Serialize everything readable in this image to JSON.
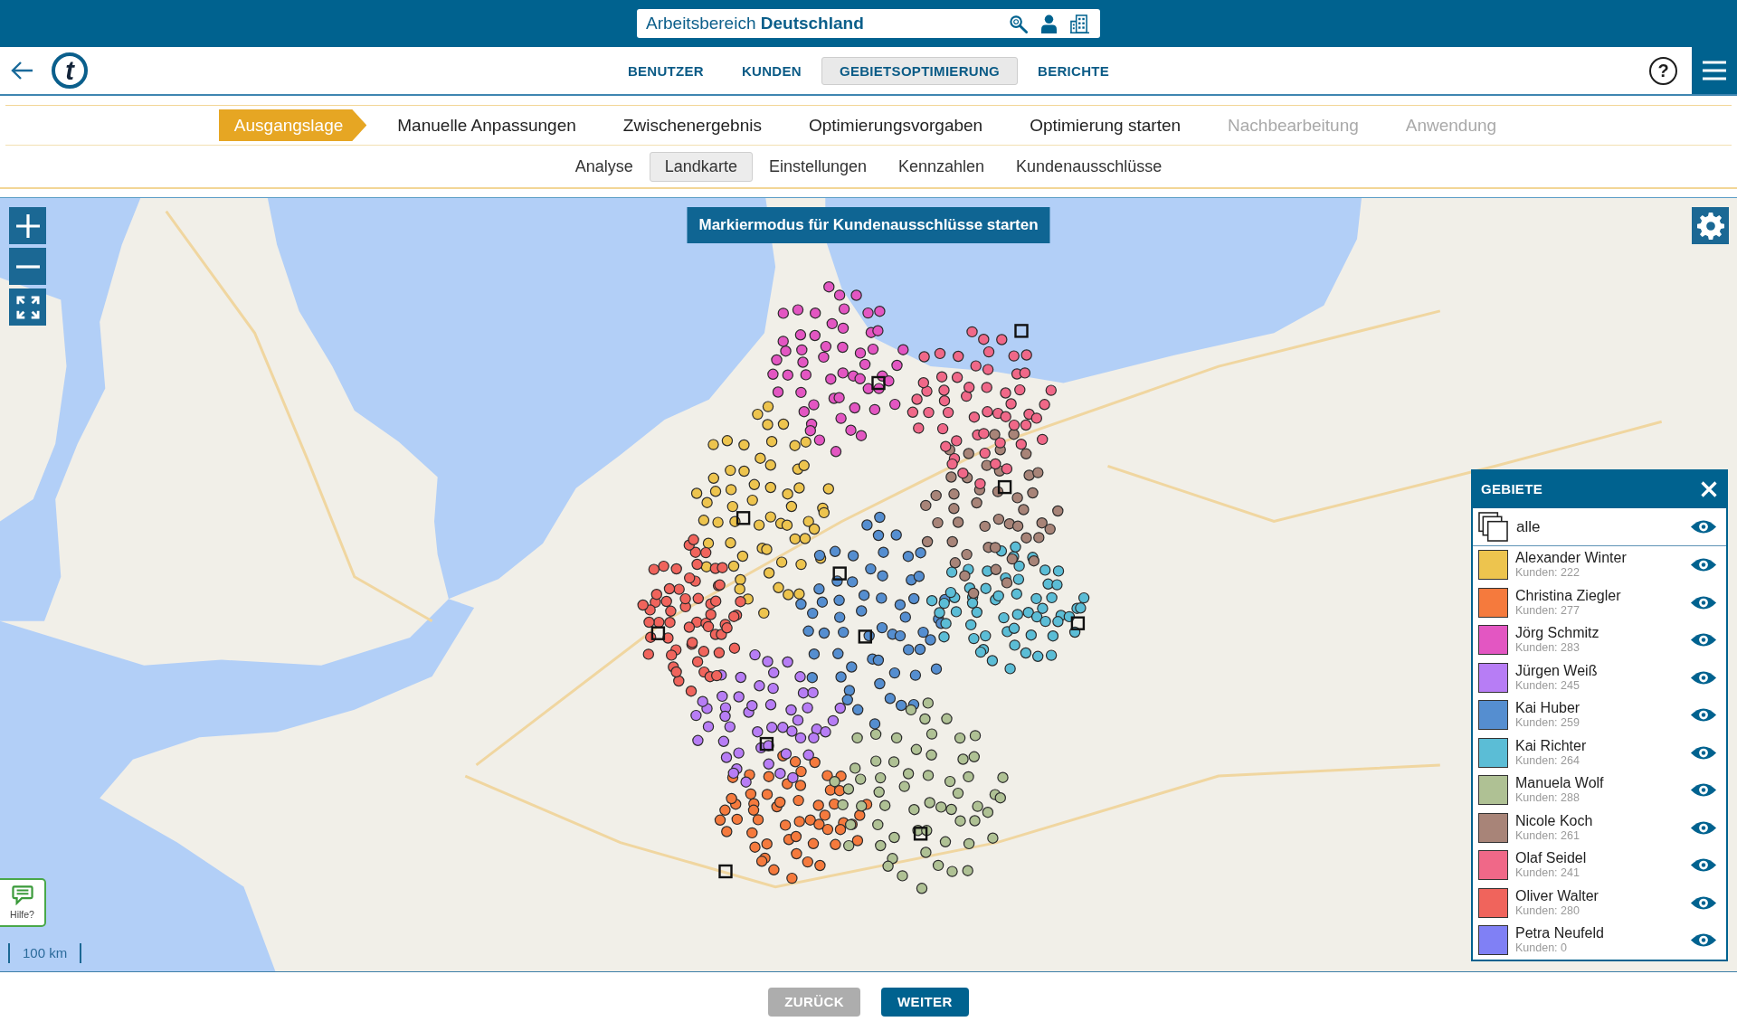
{
  "top_bar": {
    "workspace": "Arbeitsbereich **Deutschland**"
  },
  "nav": {
    "logo": "t",
    "tabs": [
      {
        "label": "BENUTZER",
        "selected": false
      },
      {
        "label": "KUNDEN",
        "selected": false
      },
      {
        "label": "GEBIETSOPTIMIERUNG",
        "selected": true
      },
      {
        "label": "BERICHTE",
        "selected": false
      }
    ],
    "help": "?"
  },
  "steps": [
    {
      "label": "Ausgangslage",
      "selected": true,
      "disabled": false
    },
    {
      "label": "Manuelle Anpassungen",
      "selected": false,
      "disabled": false
    },
    {
      "label": "Zwischenergebnis",
      "selected": false,
      "disabled": false
    },
    {
      "label": "Optimierungsvorgaben",
      "selected": false,
      "disabled": false
    },
    {
      "label": "Optimierung starten",
      "selected": false,
      "disabled": false
    },
    {
      "label": "Nachbearbeitung",
      "selected": false,
      "disabled": true
    },
    {
      "label": "Anwendung",
      "selected": false,
      "disabled": true
    }
  ],
  "subtabs": [
    {
      "label": "Analyse",
      "selected": false
    },
    {
      "label": "Landkarte",
      "selected": true
    },
    {
      "label": "Einstellungen",
      "selected": false
    },
    {
      "label": "Kennzahlen",
      "selected": false
    },
    {
      "label": "Kundenausschlüsse",
      "selected": false
    }
  ],
  "map": {
    "mark_button": "Markiermodus für Kundenausschlüsse starten",
    "help_button": "Hilfe?",
    "scale": "100 km"
  },
  "legend": {
    "title": "GEBIETE",
    "all": {
      "label": "alle",
      "visible": true
    },
    "territories": [
      {
        "name": "Alexander Winter",
        "count": "Kunden: 222",
        "color": "#edc44e",
        "visible": true
      },
      {
        "name": "Christina Ziegler",
        "count": "Kunden: 277",
        "color": "#f57a3d",
        "visible": true
      },
      {
        "name": "Jörg Schmitz",
        "count": "Kunden: 283",
        "color": "#e356c2",
        "visible": true
      },
      {
        "name": "Jürgen Weiß",
        "count": "Kunden: 245",
        "color": "#b77df5",
        "visible": true
      },
      {
        "name": "Kai Huber",
        "count": "Kunden: 259",
        "color": "#558ed0",
        "visible": true
      },
      {
        "name": "Kai Richter",
        "count": "Kunden: 264",
        "color": "#5bbdd6",
        "visible": true
      },
      {
        "name": "Manuela Wolf",
        "count": "Kunden: 288",
        "color": "#afc194",
        "visible": true
      },
      {
        "name": "Nicole Koch",
        "count": "Kunden: 261",
        "color": "#a88478",
        "visible": true
      },
      {
        "name": "Olaf Seidel",
        "count": "Kunden: 241",
        "color": "#f06888",
        "visible": true
      },
      {
        "name": "Oliver Walter",
        "count": "Kunden: 280",
        "color": "#f0645c",
        "visible": true
      },
      {
        "name": "Petra Neufeld",
        "count": "Kunden: 0",
        "color": "#8080f5",
        "visible": true
      }
    ]
  },
  "footer": {
    "buttons": [
      {
        "label": "ZURÜCK",
        "disabled": true
      },
      {
        "label": "WEITER",
        "disabled": false
      }
    ]
  }
}
